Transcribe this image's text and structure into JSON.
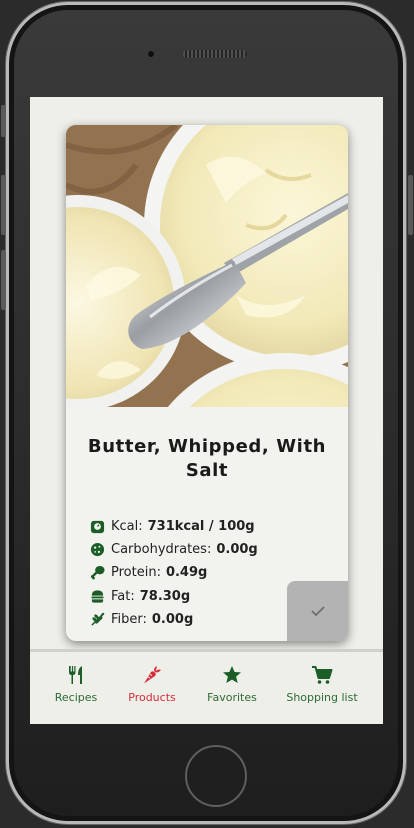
{
  "product": {
    "name": "Butter, Whipped, With Salt",
    "image_alt": "Whipped butter in bowls with a butter knife"
  },
  "nutrition": [
    {
      "label": "Kcal:",
      "value": "731kcal / 100g",
      "icon": "scale-icon"
    },
    {
      "label": "Carbohydrates:",
      "value": "0.00g",
      "icon": "cookie-icon"
    },
    {
      "label": "Protein:",
      "value": "0.49g",
      "icon": "drumstick-icon"
    },
    {
      "label": "Fat:",
      "value": "78.30g",
      "icon": "burger-icon"
    },
    {
      "label": "Fiber:",
      "value": "0.00g",
      "icon": "wheat-icon"
    }
  ],
  "nav": {
    "items": [
      {
        "label": "Recipes",
        "icon": "utensils-icon",
        "active": false
      },
      {
        "label": "Products",
        "icon": "carrot-icon",
        "active": true
      },
      {
        "label": "Favorites",
        "icon": "star-icon",
        "active": false
      },
      {
        "label": "Shopping list",
        "icon": "cart-icon",
        "active": false
      }
    ]
  },
  "colors": {
    "icon_green": "#1c5d28",
    "active_red": "#d62c3a",
    "nav_text": "#2d6a35",
    "check_button": "#b3b3b3"
  }
}
